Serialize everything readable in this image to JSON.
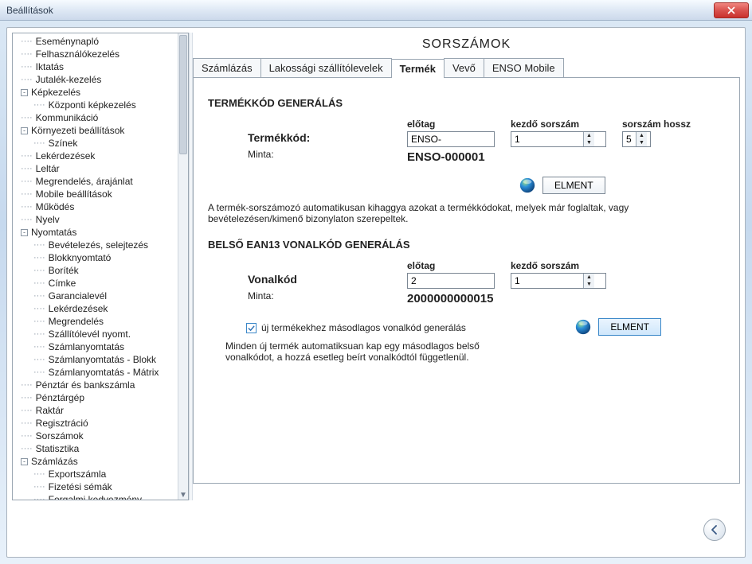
{
  "window": {
    "title": "Beállítások"
  },
  "tree": {
    "items": [
      {
        "label": "Eseménynapló"
      },
      {
        "label": "Felhasználókezelés"
      },
      {
        "label": "Iktatás"
      },
      {
        "label": "Jutalék-kezelés"
      },
      {
        "label": "Képkezelés",
        "twisty": "-",
        "children": [
          {
            "label": "Központi képkezelés"
          }
        ]
      },
      {
        "label": "Kommunikáció"
      },
      {
        "label": "Környezeti beállítások",
        "twisty": "-",
        "children": [
          {
            "label": "Színek"
          }
        ]
      },
      {
        "label": "Lekérdezések"
      },
      {
        "label": "Leltár"
      },
      {
        "label": "Megrendelés, árajánlat"
      },
      {
        "label": "Mobile beállítások"
      },
      {
        "label": "Működés"
      },
      {
        "label": "Nyelv"
      },
      {
        "label": "Nyomtatás",
        "twisty": "-",
        "children": [
          {
            "label": "Bevételezés, selejtezés"
          },
          {
            "label": "Blokknyomtató"
          },
          {
            "label": "Boríték"
          },
          {
            "label": "Címke"
          },
          {
            "label": "Garancialevél"
          },
          {
            "label": "Lekérdezések"
          },
          {
            "label": "Megrendelés"
          },
          {
            "label": "Szállítólevél nyomt."
          },
          {
            "label": "Számlanyomtatás"
          },
          {
            "label": "Számlanyomtatás - Blokk"
          },
          {
            "label": "Számlanyomtatás - Mátrix"
          }
        ]
      },
      {
        "label": "Pénztár és bankszámla"
      },
      {
        "label": "Pénztárgép"
      },
      {
        "label": "Raktár"
      },
      {
        "label": "Regisztráció"
      },
      {
        "label": "Sorszámok"
      },
      {
        "label": "Statisztika"
      },
      {
        "label": "Számlázás",
        "twisty": "-",
        "children": [
          {
            "label": "Exportszámla"
          },
          {
            "label": "Fizetési sémák"
          },
          {
            "label": "Forgalmi kedvezmény"
          }
        ]
      }
    ]
  },
  "main": {
    "title": "SORSZÁMOK",
    "tabs": [
      "Számlázás",
      "Lakossági szállítólevelek",
      "Termék",
      "Vevő",
      "ENSO Mobile"
    ],
    "active_tab": 2
  },
  "product_code": {
    "section_title": "TERMÉKKÓD GENERÁLÁS",
    "label_main": "Termékkód:",
    "label_sample": "Minta:",
    "cap_prefix": "előtag",
    "cap_startnum": "kezdő sorszám",
    "cap_len": "sorszám hossz",
    "prefix_value": "ENSO-",
    "start_value": "1",
    "len_value": "5",
    "sample_value": "ENSO-000001",
    "save_btn": "ELMENT",
    "info": "A termék-sorszámozó automatikusan kihaggya azokat a termékkódokat, melyek már foglaltak, vagy bevételezésen/kimenő bizonylaton szerepeltek."
  },
  "ean": {
    "section_title": "BELSŐ EAN13 VONALKÓD GENERÁLÁS",
    "label_main": "Vonalkód",
    "label_sample": "Minta:",
    "cap_prefix": "előtag",
    "cap_startnum": "kezdő sorszám",
    "prefix_value": "2",
    "start_value": "1",
    "sample_value": "2000000000015",
    "checkbox_label": "új termékekhez másodlagos vonalkód generálás",
    "save_btn": "ELMENT",
    "info": "Minden új termék automatiksuan kap egy másodlagos belső vonalkódot, a hozzá esetleg beírt vonalkódtól függetlenül."
  }
}
